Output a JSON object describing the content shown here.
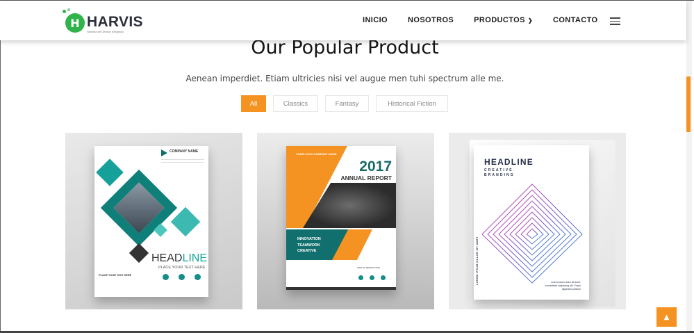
{
  "header": {
    "logo_letter": "H",
    "logo_title": "HARVIS",
    "logo_tagline": "Sistema de Gestión Integrado",
    "nav": [
      {
        "label": "INICIO"
      },
      {
        "label": "NOSOTROS"
      },
      {
        "label": "PRODUCTOS",
        "has_dropdown": true
      },
      {
        "label": "CONTACTO"
      }
    ],
    "menu_icon": "hamburger-menu-icon"
  },
  "section": {
    "title": "Our Popular Product",
    "subtitle": "Aenean imperdiet. Etiam ultricies nisi vel augue men tuhi spectrum alle me.",
    "filters": [
      {
        "label": "All",
        "active": true
      },
      {
        "label": "Classics",
        "active": false
      },
      {
        "label": "Fantasy",
        "active": false
      },
      {
        "label": "Historical Fiction",
        "active": false
      }
    ]
  },
  "products": [
    {
      "company": "COMPANY NAME",
      "headline_dark": "HEAD",
      "headline_accent": "LINE",
      "placeholder": "PLACE YOUR TEXT HERE",
      "small_text": "PLACE YOUR TEXT HERE"
    },
    {
      "logo_text": "YOUR LOGO COMPANY NAME",
      "year": "2017",
      "title": "ANNUAL REPORT",
      "tags": [
        "INNOVATION",
        "TEAMWORK",
        "CREATIVE"
      ],
      "footer": "ANNUAL REPORT 2016"
    },
    {
      "headline": "HEADLINE",
      "sub1": "CREATIVE",
      "sub2": "BRANDING",
      "vertical_text": "LOREM IPSUM DOLOR SIT AMET",
      "body": "Lorem ipsum dolor sit amet, consectetur adipiscing elit. Fusce dignissim pretium"
    }
  ],
  "scroll_top_icon": "chevron-up-icon",
  "colors": {
    "accent": "#f59322",
    "teal": "#0f7f7a",
    "brand_green": "#2fb34a",
    "navy": "#1f2a44"
  }
}
